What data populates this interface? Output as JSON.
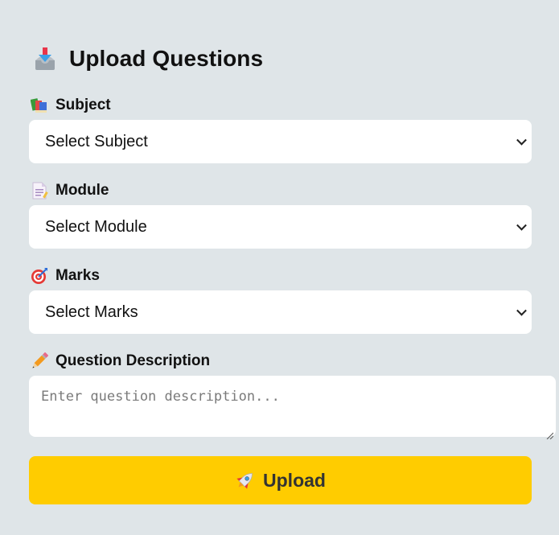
{
  "form": {
    "title": "Upload Questions",
    "title_icon": "inbox-tray-icon",
    "subject": {
      "label": "Subject",
      "icon": "books-icon",
      "selected": "Select Subject"
    },
    "module": {
      "label": "Module",
      "icon": "document-icon",
      "selected": "Select Module"
    },
    "marks": {
      "label": "Marks",
      "icon": "target-icon",
      "selected": "Select Marks"
    },
    "description": {
      "label": "Question Description",
      "icon": "pencil-icon",
      "placeholder": "Enter question description..."
    },
    "submit": {
      "label": "Upload",
      "icon": "rocket-icon"
    }
  },
  "colors": {
    "page_background": "#dfe5e8",
    "button_background": "#ffcc00",
    "input_background": "#ffffff"
  }
}
